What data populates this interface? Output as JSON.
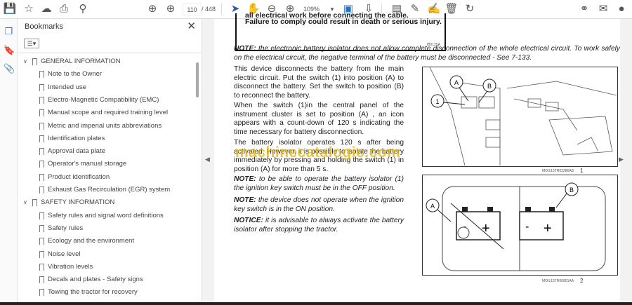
{
  "toolbar": {
    "page_current": "110",
    "page_total": "/ 448",
    "zoom": "109%"
  },
  "sidebar": {
    "title": "Bookmarks",
    "items": [
      {
        "label": "GENERAL INFORMATION",
        "level": 0
      },
      {
        "label": "Note to the Owner",
        "level": 1
      },
      {
        "label": "Intended use",
        "level": 1
      },
      {
        "label": "Electro-Magnetic Compatibility (EMC)",
        "level": 1
      },
      {
        "label": "Manual scope and required training level",
        "level": 1
      },
      {
        "label": "Metric and imperial units abbreviations",
        "level": 1
      },
      {
        "label": "Identification plates",
        "level": 1
      },
      {
        "label": "Approval data plate",
        "level": 1
      },
      {
        "label": "Operator's manual storage",
        "level": 1
      },
      {
        "label": "Product identification",
        "level": 1
      },
      {
        "label": "Exhaust Gas Recirculation (EGR) system",
        "level": 1
      },
      {
        "label": "SAFETY INFORMATION",
        "level": 0
      },
      {
        "label": "Safety rules and signal word definitions",
        "level": 1
      },
      {
        "label": "Safety rules",
        "level": 1
      },
      {
        "label": "Ecology and the environment",
        "level": 1
      },
      {
        "label": "Noise level",
        "level": 1
      },
      {
        "label": "Vibration levels",
        "level": 1
      },
      {
        "label": "Decals and plates - Safety signs",
        "level": 1
      },
      {
        "label": "Towing the tractor for recovery",
        "level": 1
      }
    ]
  },
  "document": {
    "warning_line1": "all electrical work before connecting the cable.",
    "warning_line2": "Failure to comply could result in death or serious injury.",
    "warning_code": "IB0125A",
    "note1_label": "NOTE:",
    "note1_text": " the electronic battery isolator does not allow complete disconnection of the whole electrical circuit.  To work safely on the electrical circuit, the negative terminal of the battery must be disconnected - See 7-133.",
    "para1": "This device disconnects the battery from the main electric circuit.  Put the switch (1) into position (A) to disconnect the battery.  Set the switch to position (B) to reconnect the battery.",
    "para2": "When the switch (1)in the central panel of the instrument cluster is set to position (A) , an icon appears with a count-down of 120 s indicating the time necessary for battery disconnection.",
    "para3": "The battery isolator operates 120 s after being activated. However, it is possible to isolate the battery immediately by pressing and holding the switch (1) in position (A) for more than 5 s.",
    "note2_label": "NOTE:",
    "note2_text": " to be able to operate the battery isolator (1) the ignition key switch must be in the OFF position.",
    "note3_label": "NOTE:",
    "note3_text": " the device does not operate when the ignition key switch is in the ON position.",
    "note4_label": "NOTICE:",
    "note4_text": " it is advisable to always activate the battery isolator after stopping the tractor.",
    "fig1_caption": "MOIL15TR02286AB",
    "fig1_number": "1",
    "fig2_caption": "MOIL15TR00801AA",
    "fig2_number": "2",
    "fig1_labels": [
      "A",
      "B",
      "1"
    ],
    "fig2_labels": [
      "A",
      "B"
    ],
    "watermark": "machinecatalogic.com"
  }
}
